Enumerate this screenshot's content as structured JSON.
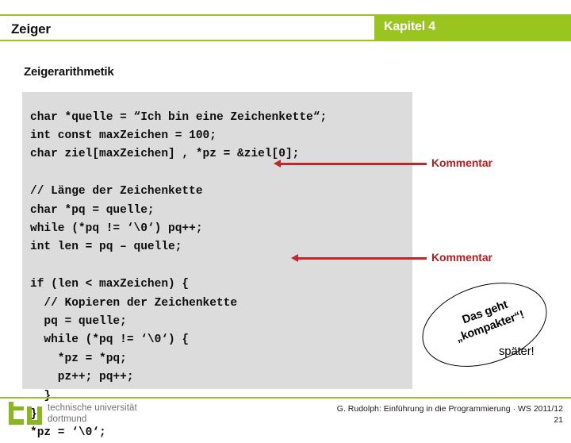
{
  "header": {
    "title": "Zeiger",
    "chapter": "Kapitel 4",
    "accent_color": "#9ac41e",
    "chapter_text_color": "#ffffff"
  },
  "section": {
    "heading": "Zeigerarithmetik"
  },
  "code_block": {
    "background_color": "#dcdcdc",
    "text_color": "#0d0d0d",
    "lines": [
      "char *quelle = “Ich bin eine Zeichenkette“;",
      "int const maxZeichen = 100;",
      "char ziel[maxZeichen] , *pz = &ziel[0];",
      "",
      "// Länge der Zeichenkette",
      "char *pq = quelle;",
      "while (*pq != ‘\\0‘) pq++;",
      "int len = pq – quelle;",
      "",
      "if (len < maxZeichen) {",
      "  // Kopieren der Zeichenkette",
      "  pq = quelle;",
      "  while (*pq != ‘\\0‘) {",
      "    *pz = *pq;",
      "    pz++; pq++;",
      "  }",
      "}",
      "*pz = ‘\\0‘;"
    ],
    "text": "char *quelle = “Ich bin eine Zeichenkette“;\nint const maxZeichen = 100;\nchar ziel[maxZeichen] , *pz = &ziel[0];\n\n// Länge der Zeichenkette\nchar *pq = quelle;\nwhile (*pq != ‘\\0‘) pq++;\nint len = pq – quelle;\n\nif (len < maxZeichen) {\n  // Kopieren der Zeichenkette\n  pq = quelle;\n  while (*pq != ‘\\0‘) {\n    *pz = *pq;\n    pz++; pq++;\n  }\n}\n*pz = ‘\\0‘;"
  },
  "annotations": {
    "color": "#b02020",
    "arrow_color": "#c0262a",
    "items": [
      {
        "label": "Kommentar",
        "points_to": "// Länge der Zeichenkette"
      },
      {
        "label": "Kommentar",
        "points_to": "// Kopieren der Zeichenkette"
      }
    ]
  },
  "callout": {
    "line1": "Das geht",
    "line2": "„kompakter“!",
    "text": "Das geht „kompakter“!"
  },
  "later_note": "später!",
  "footer": {
    "logo_mark": "tu-logo-icon",
    "logo_line1": "technische universität",
    "logo_line2": "dortmund",
    "credit": "G. Rudolph: Einführung in die Programmierung · WS 2011/12",
    "page_number": "21",
    "rule_color": "#9ac41e"
  }
}
